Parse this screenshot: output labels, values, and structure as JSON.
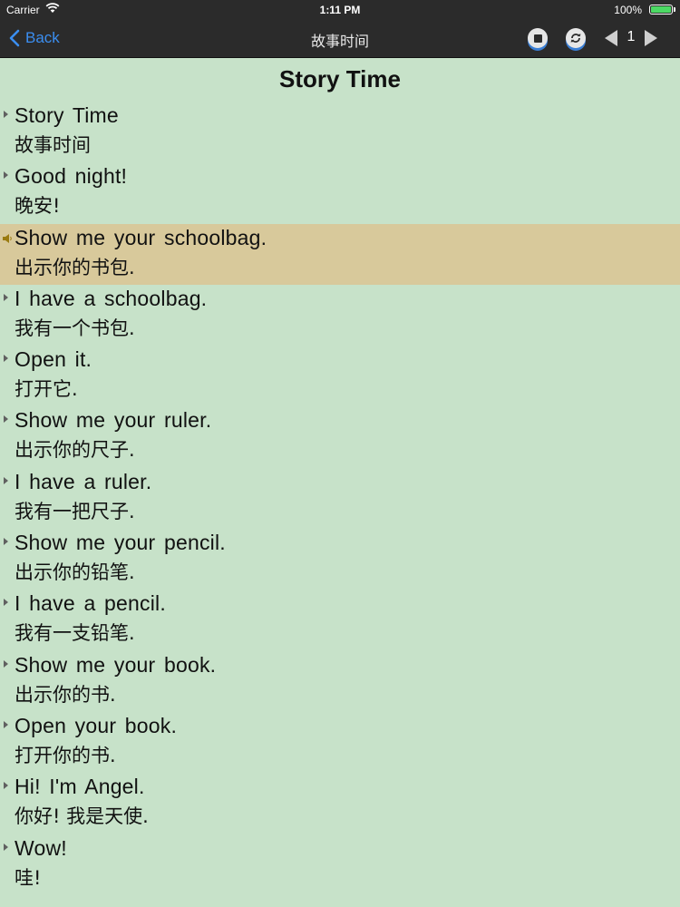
{
  "status": {
    "carrier": "Carrier",
    "time": "1:11 PM",
    "battery": "100%"
  },
  "nav": {
    "back_label": "Back",
    "title": "故事时间",
    "page": "1"
  },
  "heading": "Story Time",
  "active_index": 2,
  "lines": [
    {
      "en": "Story Time",
      "zh": "故事时间"
    },
    {
      "en": "Good night!",
      "zh": "晚安!"
    },
    {
      "en": "Show me your schoolbag.",
      "zh": "出示你的书包."
    },
    {
      "en": "I have a schoolbag.",
      "zh": "我有一个书包."
    },
    {
      "en": "Open it.",
      "zh": "打开它."
    },
    {
      "en": "Show me your ruler.",
      "zh": "出示你的尺子."
    },
    {
      "en": "I have a ruler.",
      "zh": "我有一把尺子."
    },
    {
      "en": "Show me your pencil.",
      "zh": "出示你的铅笔."
    },
    {
      "en": "I have a pencil.",
      "zh": "我有一支铅笔."
    },
    {
      "en": "Show me your book.",
      "zh": "出示你的书."
    },
    {
      "en": "Open your book.",
      "zh": "打开你的书."
    },
    {
      "en": "Hi! I'm Angel.",
      "zh": "你好! 我是天使."
    },
    {
      "en": "Wow!",
      "zh": "哇!"
    }
  ]
}
